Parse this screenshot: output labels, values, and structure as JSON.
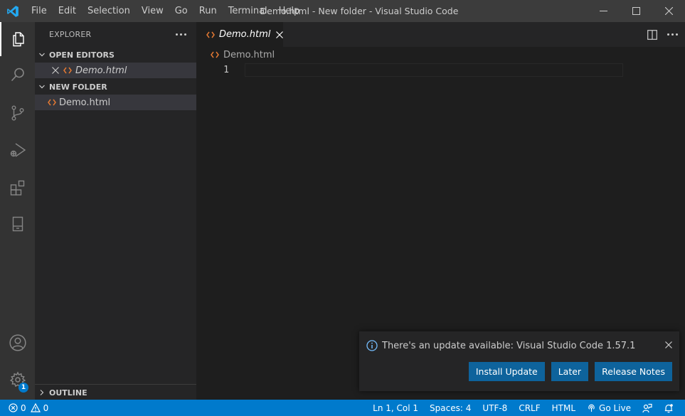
{
  "menu": [
    "File",
    "Edit",
    "Selection",
    "View",
    "Go",
    "Run",
    "Terminal",
    "Help"
  ],
  "window_title": "Demo.html - New folder - Visual Studio Code",
  "activity_badge": "1",
  "sidebar": {
    "title": "EXPLORER",
    "open_editors": {
      "label": "OPEN EDITORS",
      "items": [
        "Demo.html"
      ]
    },
    "folder": {
      "label": "NEW FOLDER",
      "items": [
        "Demo.html"
      ]
    },
    "outline": {
      "label": "OUTLINE"
    }
  },
  "editor": {
    "tab_label": "Demo.html",
    "breadcrumb": "Demo.html",
    "line_number": "1"
  },
  "notification": {
    "message": "There's an update available: Visual Studio Code 1.57.1",
    "buttons": {
      "install": "Install Update",
      "later": "Later",
      "notes": "Release Notes"
    }
  },
  "statusbar": {
    "errors": "0",
    "warnings": "0",
    "position": "Ln 1, Col 1",
    "spaces": "Spaces: 4",
    "encoding": "UTF-8",
    "eol": "CRLF",
    "language": "HTML",
    "go_live": "Go Live"
  },
  "colors": {
    "accent": "#007acc",
    "button": "#0e639c",
    "html_icon": "#e37933",
    "title_bar": "#3c3c3c",
    "editor_bg": "#1e1e1e"
  },
  "icons": {
    "activity": [
      "files-icon",
      "search-icon",
      "source-control-icon",
      "run-debug-icon",
      "extensions-icon",
      "remote-explorer-icon",
      "account-icon",
      "settings-gear-icon"
    ],
    "file": "html-file-icon"
  }
}
